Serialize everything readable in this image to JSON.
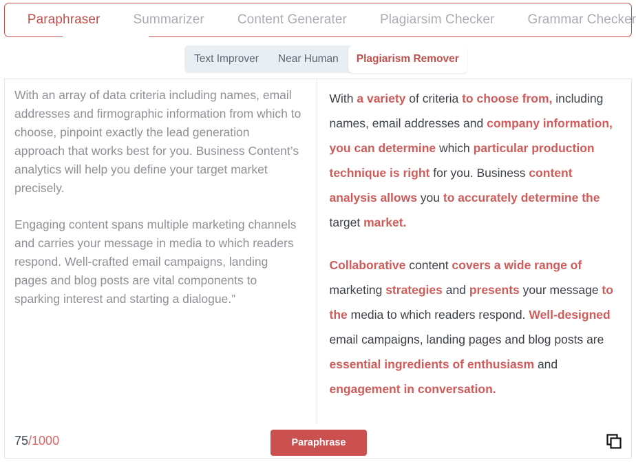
{
  "main_tabs": [
    {
      "label": "Paraphraser",
      "active": true
    },
    {
      "label": "Summarizer",
      "active": false
    },
    {
      "label": "Content Generater",
      "active": false
    },
    {
      "label": "Plagiarsim Checker",
      "active": false
    },
    {
      "label": "Grammar Checker",
      "active": false
    }
  ],
  "sub_tabs": [
    {
      "label": "Text Improver",
      "active": false
    },
    {
      "label": "Near Human",
      "active": false
    },
    {
      "label": "Plagiarism Remover",
      "active": true
    }
  ],
  "input_panel": {
    "paragraphs": [
      "With an array of data criteria including names, email addresses and firmographic information from which to choose, pinpoint exactly the lead generation approach that works best for you. Business Content’s analytics will help you define your target market precisely.",
      "Engaging content spans multiple marketing channels and carries your message in media to which readers respond. Well-crafted email campaigns, landing pages and blog posts are vital components to sparking interest and starting a dialogue.”"
    ]
  },
  "output_panel": {
    "paragraphs": [
      [
        {
          "text": "With ",
          "highlight": false
        },
        {
          "text": "a variety",
          "highlight": true
        },
        {
          "text": " of criteria ",
          "highlight": false
        },
        {
          "text": "to choose from,",
          "highlight": true
        },
        {
          "text": " including names, email addresses and ",
          "highlight": false
        },
        {
          "text": "company information, you can determine",
          "highlight": true
        },
        {
          "text": " which ",
          "highlight": false
        },
        {
          "text": "particular production technique is right",
          "highlight": true
        },
        {
          "text": " for you. Business ",
          "highlight": false
        },
        {
          "text": "content analysis allows",
          "highlight": true
        },
        {
          "text": " you ",
          "highlight": false
        },
        {
          "text": "to accurately determine the",
          "highlight": true
        },
        {
          "text": " target ",
          "highlight": false
        },
        {
          "text": "market.",
          "highlight": true
        }
      ],
      [
        {
          "text": "Collaborative",
          "highlight": true
        },
        {
          "text": " content ",
          "highlight": false
        },
        {
          "text": "covers a wide range of",
          "highlight": true
        },
        {
          "text": " marketing ",
          "highlight": false
        },
        {
          "text": "strategies",
          "highlight": true
        },
        {
          "text": " and ",
          "highlight": false
        },
        {
          "text": "presents",
          "highlight": true
        },
        {
          "text": " your message ",
          "highlight": false
        },
        {
          "text": "to the",
          "highlight": true
        },
        {
          "text": " media to which readers respond. ",
          "highlight": false
        },
        {
          "text": "Well-designed",
          "highlight": true
        },
        {
          "text": " email campaigns, landing pages and blog posts are ",
          "highlight": false
        },
        {
          "text": "essential ingredients of enthusiasm",
          "highlight": true
        },
        {
          "text": " and ",
          "highlight": false
        },
        {
          "text": "engagement in conversation.",
          "highlight": true
        }
      ]
    ]
  },
  "footer": {
    "char_count": "75",
    "char_limit": "/1000",
    "paraphrase_label": "Paraphrase",
    "copy_icon": "copy-icon"
  },
  "colors": {
    "accent_red": "#c0504d",
    "highlight_red": "#cf5b5b",
    "button_red": "#cb5050",
    "muted_text": "#8d9196",
    "body_text": "#3d4148",
    "subtab_bg": "#e9eef3",
    "border": "#e3e6ea"
  }
}
